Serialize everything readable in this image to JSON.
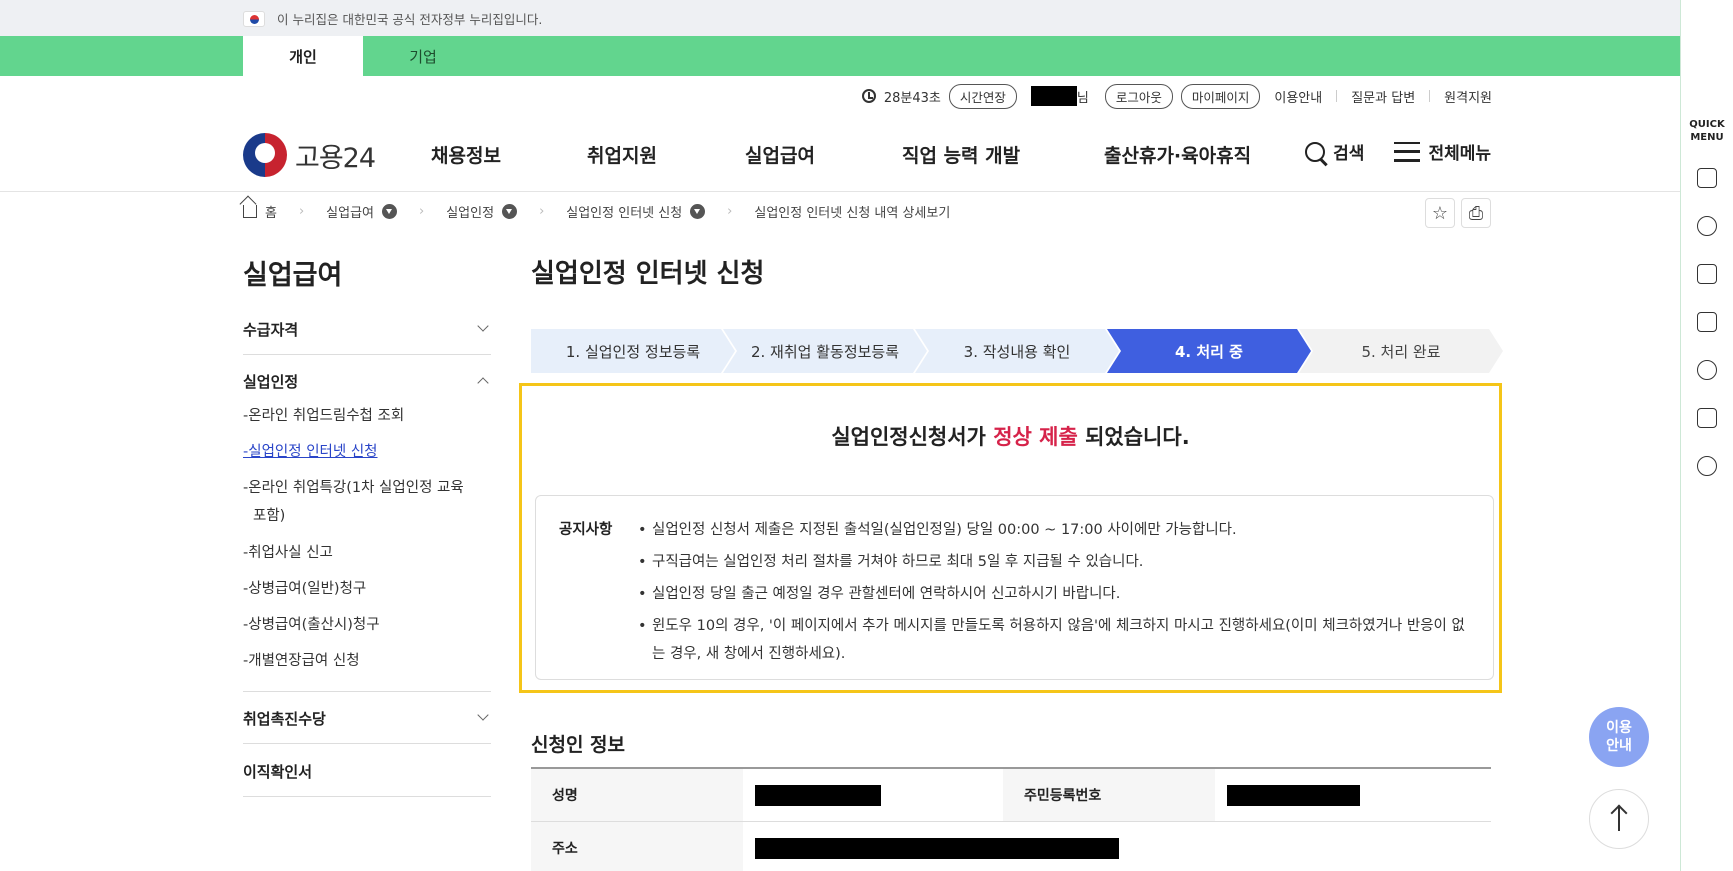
{
  "gov_notice": "이 누리집은 대한민국 공식 전자정부 누리집입니다.",
  "tabs": {
    "personal": "개인",
    "business": "기업"
  },
  "utility": {
    "timer": "28분43초",
    "extend": "시간연장",
    "suffix": "님",
    "logout": "로그아웃",
    "mypage": "마이페이지",
    "guide": "이용안내",
    "qna": "질문과 답변",
    "remote": "원격지원"
  },
  "logo_text": "고용24",
  "gnb": [
    "채용정보",
    "취업지원",
    "실업급여",
    "직업 능력 개발",
    "출산휴가·육아휴직"
  ],
  "header_right": {
    "search": "검색",
    "menu": "전체메뉴"
  },
  "breadcrumb": {
    "home": "홈",
    "items": [
      "실업급여",
      "실업인정",
      "실업인정 인터넷 신청",
      "실업인정 인터넷 신청 내역 상세보기"
    ]
  },
  "sidebar": {
    "title": "실업급여",
    "sec1": "수급자격",
    "sec2": "실업인정",
    "sub": [
      "-온라인 취업드림수첩 조회",
      "-실업인정 인터넷 신청",
      "-온라인 취업특강(1차 실업인정 교육",
      "포함)",
      "-취업사실 신고",
      "-상병급여(일반)청구",
      "-상병급여(출산시)청구",
      "-개별연장급여 신청"
    ],
    "sec3": "취업촉진수당",
    "sec4": "이직확인서"
  },
  "page_title": "실업인정 인터넷 신청",
  "steps": [
    "1. 실업인정 정보등록",
    "2. 재취업 활동정보등록",
    "3. 작성내용 확인",
    "4. 처리 중",
    "5. 처리 완료"
  ],
  "result": {
    "before": "실업인정신청서가 ",
    "highlight": "정상 제출",
    "after": " 되었습니다.",
    "highlight_color": "#d6234a"
  },
  "notice": {
    "label": "공지사항",
    "items": [
      "실업인정 신청서 제출은 지정된 출석일(실업인정일) 당일 00:00 ~ 17:00 사이에만 가능합니다.",
      "구직급여는 실업인정 처리 절차를 거쳐야 하므로 최대 5일 후 지급될 수 있습니다.",
      "실업인정 당일 출근 예정일 경우 관할센터에 연락하시어 신고하시기 바랍니다.",
      "윈도우 10의 경우, '이 페이지에서 추가 메시지를 만들도록 허용하지 않음'에 체크하지 마시고 진행하세요(이미 체크하였거나 반응이 없는 경우, 새 창에서 진행하세요)."
    ]
  },
  "applicant": {
    "title": "신청인 정보",
    "name_label": "성명",
    "rrn_label": "주민등록번호",
    "address_label": "주소"
  },
  "quick_menu": {
    "title": "QUICK MENU"
  },
  "floating": {
    "guide": "이용\n안내"
  },
  "colors": {
    "green": "#62d58e",
    "active_step": "#3f5fe0",
    "highlight_border": "#f5c518"
  }
}
